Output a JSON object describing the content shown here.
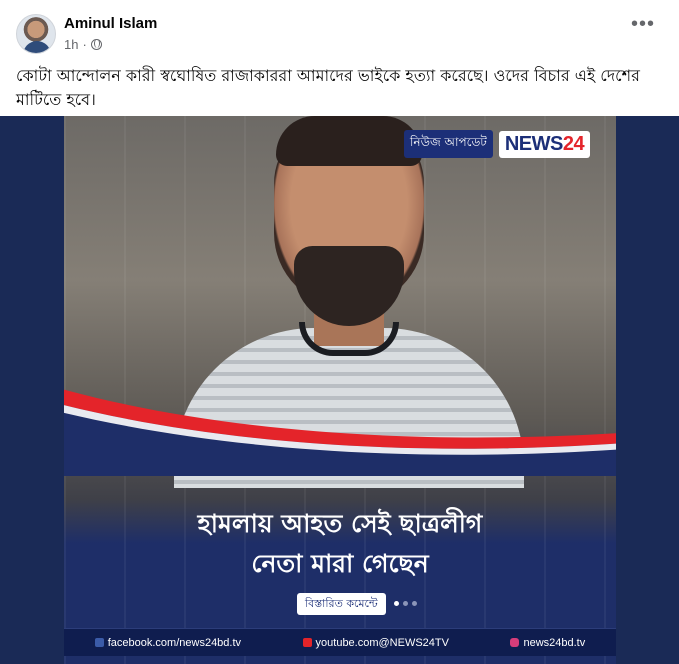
{
  "post": {
    "author": "Aminul Islam",
    "timestamp": "1h",
    "text": "কোটা আন্দোলন কারী স্বঘোষিত রাজাকাররা আমাদের ভাইকে হত্যা করেছে। ওদের বিচার এই দেশের মাটিতে হবে।",
    "more_icon": "•••",
    "privacy_icon": "globe-icon"
  },
  "media": {
    "logo_badge": "নিউজ আপডেট",
    "logo_main": "NEWS",
    "logo_accent": "24",
    "headline_line1": "হামলায় আহত সেই ছাত্রলীগ",
    "headline_line2": "নেতা মারা গেছেন",
    "details_button": "বিস্তারিত কমেন্টে",
    "footer": {
      "facebook": "facebook.com/news24bd.tv",
      "youtube": "youtube.com@NEWS24TV",
      "instagram": "news24bd.tv"
    },
    "colors": {
      "brand_blue": "#1c2f78",
      "brand_red": "#e4242a"
    }
  }
}
